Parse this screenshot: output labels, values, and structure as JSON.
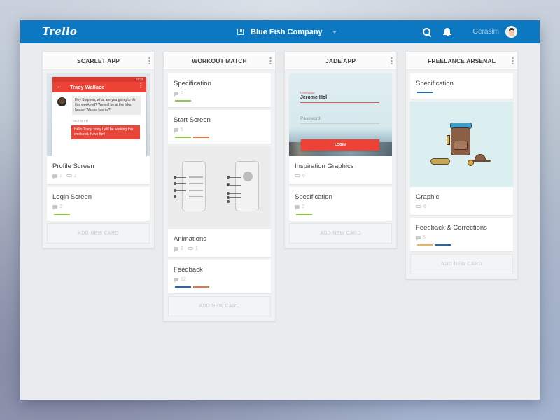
{
  "app": {
    "logo": "Trello",
    "board_name": "Blue Fish Company",
    "username": "Gerasim",
    "icons": {
      "board": "board-icon",
      "dropdown": "caret-down-icon",
      "search": "search-icon",
      "notifications": "bell-icon",
      "avatar": "user-avatar"
    }
  },
  "colors": {
    "brand": "#0c78c2",
    "label_green": "#8dc63f",
    "label_orange": "#e9733f",
    "label_blue": "#1e68b0",
    "label_yellow": "#f0b449",
    "accent_red": "#ec4336"
  },
  "add_card_label": "ADD NEW CARD",
  "lists": [
    {
      "title": "SCARLET APP",
      "cards": [
        {
          "title": "Profile Screen",
          "cover": "chat",
          "comments": "2",
          "attachments": "2",
          "chat_cover": {
            "status_time": "12:30",
            "contact": "Tracy Wallace",
            "incoming": "Hey Stephen, what are you going to do this weekend? We will be at the lake house. Wanna join us?",
            "timestamp": "Thu 2:35 PM",
            "outgoing": "Hello Tracy, sorry I will be working this weekend. Have fun!"
          }
        },
        {
          "title": "Login Screen",
          "comments": "2",
          "labels": [
            "green"
          ]
        }
      ]
    },
    {
      "title": "WORKOUT MATCH",
      "cards": [
        {
          "title": "Specification",
          "comments": "1",
          "labels": [
            "green"
          ]
        },
        {
          "title": "Start Screen",
          "comments": "5",
          "labels": [
            "green",
            "orange"
          ]
        },
        {
          "title": "Animations",
          "cover": "wireframe",
          "comments": "2",
          "attachments": "1"
        },
        {
          "title": "Feedback",
          "comments": "12",
          "labels": [
            "blue",
            "orange"
          ]
        }
      ]
    },
    {
      "title": "JADE APP",
      "cards": [
        {
          "title": "Inspiration Graphics",
          "cover": "login",
          "attachments": "6",
          "login_cover": {
            "username_label": "Username",
            "username_value": "Jerome Hol",
            "password_placeholder": "Password",
            "button": "LOGIN"
          }
        },
        {
          "title": "Specification",
          "comments": "2",
          "labels": [
            "green"
          ]
        }
      ]
    },
    {
      "title": "FREELANCE ARSENAL",
      "cards": [
        {
          "title": "Specification",
          "labels": [
            "blue"
          ]
        },
        {
          "title": "Graphic",
          "cover": "backpack",
          "attachments": "6"
        },
        {
          "title": "Feedback & Corrections",
          "comments": "5",
          "labels": [
            "yellow",
            "blue"
          ]
        }
      ]
    }
  ]
}
